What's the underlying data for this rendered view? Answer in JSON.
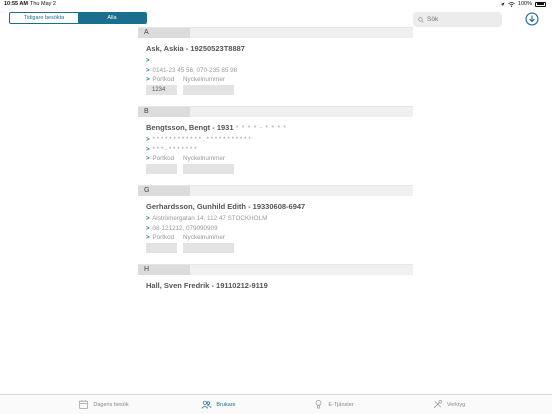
{
  "status_bar": {
    "time": "10:55 AM",
    "date": "Thu May 2",
    "battery": "100%"
  },
  "segmented": {
    "options": [
      "Tidigare besökta",
      "Alla"
    ],
    "selected": "Alla"
  },
  "search": {
    "placeholder": "Sök"
  },
  "sections": [
    {
      "letter": "A",
      "entries": [
        {
          "name": "Ask, Askia - 19250523T8887",
          "lines": [
            ">",
            "> 0141-23 45 56, 070-235 85 98"
          ],
          "labels": [
            "> Portkod",
            "Nyckelnummer"
          ],
          "portkod": "1234",
          "nyckel": ""
        }
      ]
    },
    {
      "letter": "B",
      "entries": [
        {
          "name": "Bengtsson, Bengt - 1931",
          "name_masked": "* * * * - * * * *",
          "lines": [
            "> * * * * * * * * * * * * , * * * * * * * * * * *",
            "> * * * - * * * * * * *"
          ],
          "labels": [
            "> Portkod",
            "Nyckelnummer"
          ],
          "portkod": "",
          "nyckel": ""
        }
      ]
    },
    {
      "letter": "G",
      "entries": [
        {
          "name": "Gerhardsson, Gunhild Edith - 19330608-6947",
          "lines": [
            "> Alströmergatan 14, 112 47 STOCKHOLM",
            "> 08-121212, 079090909"
          ],
          "labels": [
            "> Portkod",
            "Nyckelnummer"
          ],
          "portkod": "",
          "nyckel": ""
        }
      ]
    },
    {
      "letter": "H",
      "entries": [
        {
          "name": "Hall, Sven Fredrik - 19110212-9119"
        }
      ]
    }
  ],
  "tabs": [
    {
      "label": "Dagens besök",
      "icon": "calendar-icon",
      "active": false
    },
    {
      "label": "Brukare",
      "icon": "users-icon",
      "active": true
    },
    {
      "label": "E-Tjänster",
      "icon": "lightbulb-icon",
      "active": false
    },
    {
      "label": "Verktyg",
      "icon": "tools-icon",
      "active": false
    }
  ],
  "colors": {
    "accent": "#1a6f8f",
    "section_bg": "#f0f0f0",
    "box_bg": "#e3e3e3"
  }
}
